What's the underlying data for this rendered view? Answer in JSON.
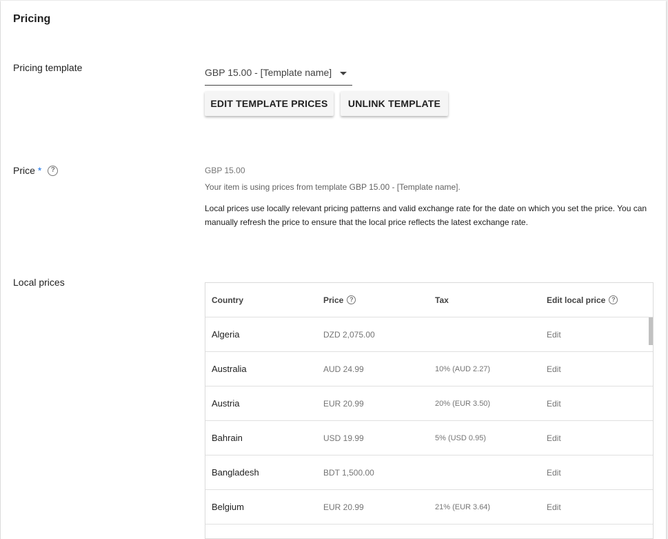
{
  "section": {
    "title": "Pricing"
  },
  "pricing_template": {
    "label": "Pricing template",
    "selected": "GBP 15.00 - [Template name]",
    "edit_button": "EDIT TEMPLATE PRICES",
    "unlink_button": "UNLINK TEMPLATE"
  },
  "price": {
    "label": "Price",
    "required_marker": "*",
    "help_glyph": "?",
    "value": "GBP 15.00",
    "note": "Your item is using prices from template GBP 15.00 - [Template name].",
    "description": "Local prices use locally relevant pricing patterns and valid exchange rate for the date on which you set the price. You can manually refresh the price to ensure that the local price reflects the latest exchange rate."
  },
  "local_prices": {
    "label": "Local prices",
    "columns": {
      "country": "Country",
      "price": "Price",
      "tax": "Tax",
      "edit": "Edit local price"
    },
    "rows": [
      {
        "country": "Algeria",
        "price": "DZD 2,075.00",
        "tax": "",
        "edit": "Edit"
      },
      {
        "country": "Australia",
        "price": "AUD 24.99",
        "tax": "10% (AUD 2.27)",
        "edit": "Edit"
      },
      {
        "country": "Austria",
        "price": "EUR 20.99",
        "tax": "20% (EUR 3.50)",
        "edit": "Edit"
      },
      {
        "country": "Bahrain",
        "price": "USD 19.99",
        "tax": "5% (USD 0.95)",
        "edit": "Edit"
      },
      {
        "country": "Bangladesh",
        "price": "BDT 1,500.00",
        "tax": "",
        "edit": "Edit"
      },
      {
        "country": "Belgium",
        "price": "EUR 20.99",
        "tax": "21% (EUR 3.64)",
        "edit": "Edit"
      },
      {
        "country": "",
        "price": "",
        "tax": "",
        "edit": ""
      }
    ]
  },
  "colors": {
    "accent": "#1a73e8",
    "background": "#eeeeee",
    "card": "#ffffff"
  }
}
